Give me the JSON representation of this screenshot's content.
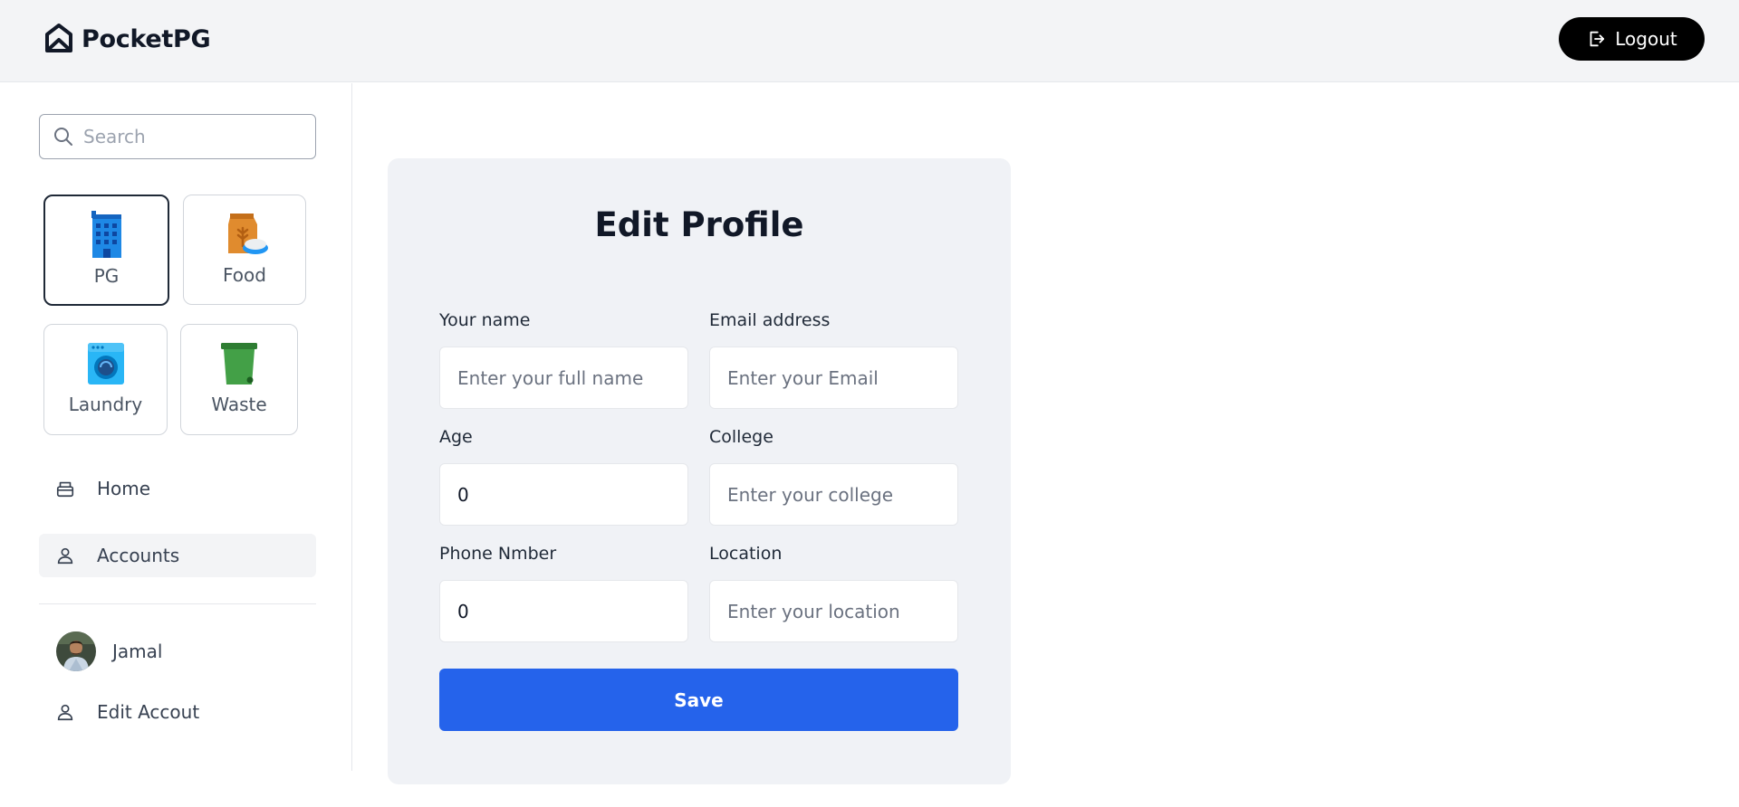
{
  "header": {
    "brand": "PocketPG",
    "logout_label": "Logout"
  },
  "sidebar": {
    "search_placeholder": "Search",
    "categories": [
      {
        "label": "PG",
        "icon": "building-icon",
        "active": true
      },
      {
        "label": "Food",
        "icon": "grain-bag-icon",
        "active": false
      },
      {
        "label": "Laundry",
        "icon": "washing-machine-icon",
        "active": false
      },
      {
        "label": "Waste",
        "icon": "trash-bin-icon",
        "active": false
      }
    ],
    "nav": [
      {
        "label": "Home",
        "icon": "home-icon",
        "active": false
      },
      {
        "label": "Accounts",
        "icon": "user-icon",
        "active": true
      }
    ],
    "user": {
      "name": "Jamal"
    },
    "edit_account_label": "Edit Accout"
  },
  "form": {
    "title": "Edit Profile",
    "fields": {
      "name": {
        "label": "Your name",
        "placeholder": "Enter your full name",
        "value": ""
      },
      "email": {
        "label": "Email address",
        "placeholder": "Enter your Email",
        "value": ""
      },
      "age": {
        "label": "Age",
        "placeholder": "",
        "value": "0"
      },
      "college": {
        "label": "College",
        "placeholder": "Enter your college",
        "value": ""
      },
      "phone": {
        "label": "Phone Nmber",
        "placeholder": "",
        "value": "0"
      },
      "location": {
        "label": "Location",
        "placeholder": "Enter your location",
        "value": ""
      }
    },
    "save_label": "Save"
  },
  "colors": {
    "accent": "#2563eb",
    "topbar_bg": "#f3f4f6",
    "card_bg": "#f0f2f6",
    "logout_bg": "#000000"
  }
}
